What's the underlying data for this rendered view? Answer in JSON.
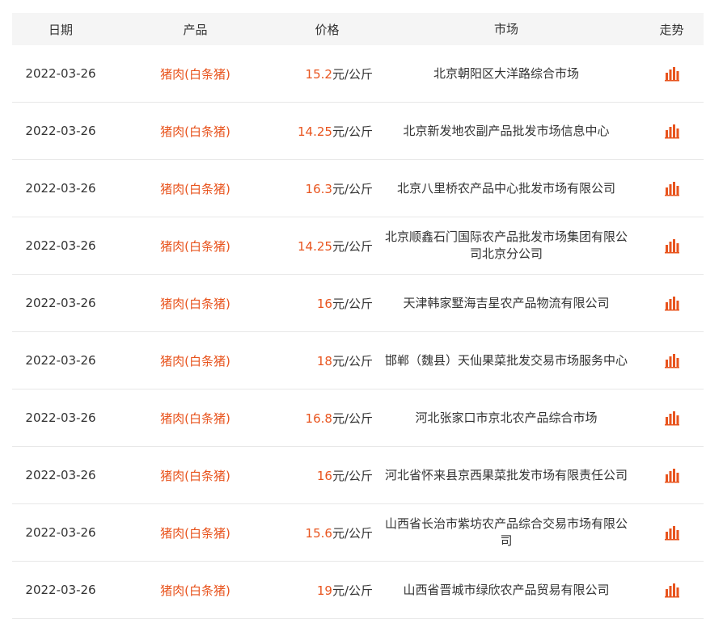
{
  "header": {
    "date": "日期",
    "product": "产品",
    "price": "价格",
    "market": "市场",
    "trend": "走势"
  },
  "rows": [
    {
      "date": "2022-03-26",
      "product": "猪肉(白条猪)",
      "price": "15.2",
      "unit": "元/公斤",
      "market": "北京朝阳区大洋路综合市场"
    },
    {
      "date": "2022-03-26",
      "product": "猪肉(白条猪)",
      "price": "14.25",
      "unit": "元/公斤",
      "market": "北京新发地农副产品批发市场信息中心"
    },
    {
      "date": "2022-03-26",
      "product": "猪肉(白条猪)",
      "price": "16.3",
      "unit": "元/公斤",
      "market": "北京八里桥农产品中心批发市场有限公司"
    },
    {
      "date": "2022-03-26",
      "product": "猪肉(白条猪)",
      "price": "14.25",
      "unit": "元/公斤",
      "market": "北京顺鑫石门国际农产品批发市场集团有限公司北京分公司"
    },
    {
      "date": "2022-03-26",
      "product": "猪肉(白条猪)",
      "price": "16",
      "unit": "元/公斤",
      "market": "天津韩家墅海吉星农产品物流有限公司"
    },
    {
      "date": "2022-03-26",
      "product": "猪肉(白条猪)",
      "price": "18",
      "unit": "元/公斤",
      "market": "邯郸（魏县）天仙果菜批发交易市场服务中心"
    },
    {
      "date": "2022-03-26",
      "product": "猪肉(白条猪)",
      "price": "16.8",
      "unit": "元/公斤",
      "market": "河北张家口市京北农产品综合市场"
    },
    {
      "date": "2022-03-26",
      "product": "猪肉(白条猪)",
      "price": "16",
      "unit": "元/公斤",
      "market": "河北省怀来县京西果菜批发市场有限责任公司"
    },
    {
      "date": "2022-03-26",
      "product": "猪肉(白条猪)",
      "price": "15.6",
      "unit": "元/公斤",
      "market": "山西省长治市紫坊农产品综合交易市场有限公司"
    },
    {
      "date": "2022-03-26",
      "product": "猪肉(白条猪)",
      "price": "19",
      "unit": "元/公斤",
      "market": "山西省晋城市绿欣农产品贸易有限公司"
    }
  ],
  "colors": {
    "accent": "#e8541e",
    "header_bg": "#f5f5f5",
    "divider": "#e8e8e8"
  },
  "icons": {
    "trend": "bar-chart-icon"
  }
}
